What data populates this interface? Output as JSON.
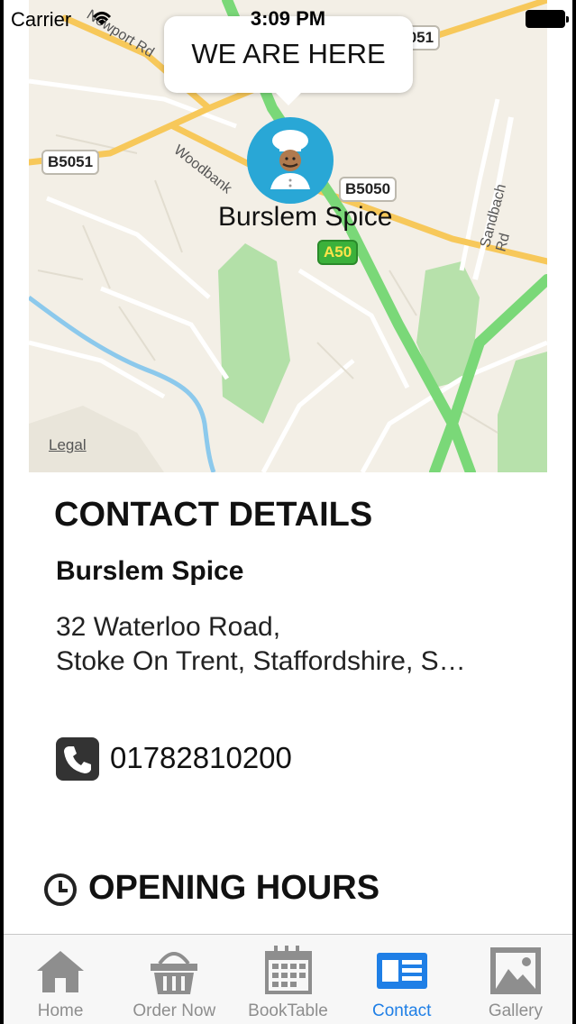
{
  "status_bar": {
    "carrier": "Carrier",
    "time": "3:09 PM"
  },
  "map": {
    "callout": "WE ARE HERE",
    "pin_label": "Burslem Spice",
    "road_labels": [
      "B5051",
      "B5051",
      "B5050",
      "A50"
    ],
    "street_labels": [
      "Woodbank",
      "Sandbach Rd",
      "Newport Rd"
    ],
    "legal": "Legal",
    "colors": {
      "land": "#f3efe6",
      "park": "#a7dd9c",
      "motorway": "#7ad878",
      "major_road": "#f7c85a",
      "water": "#8cc9ec"
    }
  },
  "contact": {
    "section_title": "CONTACT DETAILS",
    "business_name": "Burslem Spice",
    "address_line1": "32 Waterloo Road,",
    "address_line2": "Stoke On Trent, Staffordshire, S…",
    "phone": "01782810200"
  },
  "hours": {
    "section_title": "OPENING HOURS"
  },
  "tab_bar": {
    "active_color": "#1f7fe6",
    "inactive_color": "#8e8e8e",
    "tabs": [
      {
        "label": "Home",
        "icon": "home-icon"
      },
      {
        "label": "Order Now",
        "icon": "basket-icon"
      },
      {
        "label": "BookTable",
        "icon": "calendar-icon"
      },
      {
        "label": "Contact",
        "icon": "contact-card-icon",
        "active": true
      },
      {
        "label": "Gallery",
        "icon": "gallery-icon"
      }
    ]
  }
}
